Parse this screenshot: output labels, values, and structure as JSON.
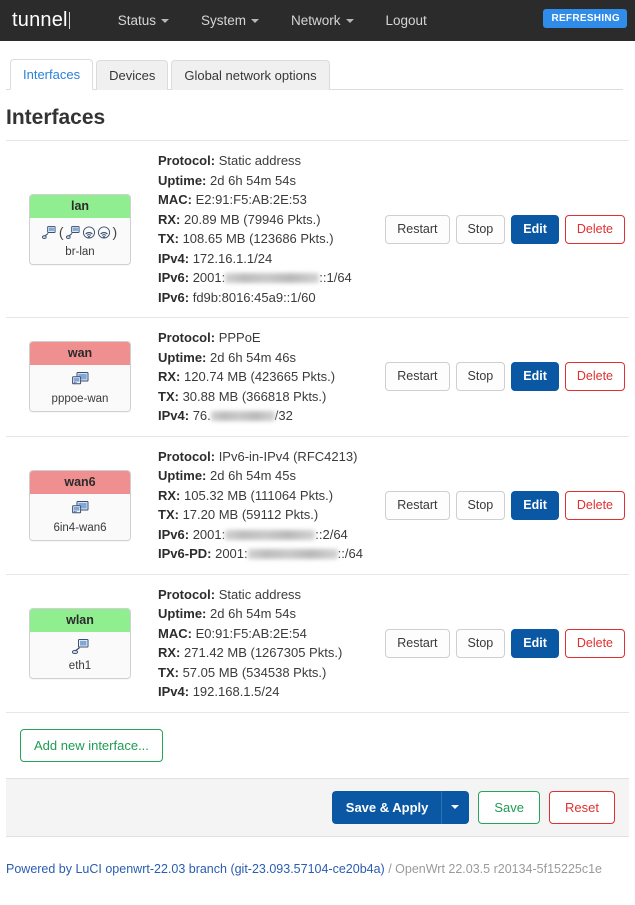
{
  "navbar": {
    "brand": "tunnel",
    "items": [
      {
        "label": "Status",
        "has_caret": true
      },
      {
        "label": "System",
        "has_caret": true
      },
      {
        "label": "Network",
        "has_caret": true
      },
      {
        "label": "Logout",
        "has_caret": false
      }
    ],
    "status_badge": "REFRESHING",
    "badge_color": "#2f8ce8",
    "background": "#2b2b2b"
  },
  "tabs": [
    {
      "label": "Interfaces",
      "active": true
    },
    {
      "label": "Devices",
      "active": false
    },
    {
      "label": "Global network options",
      "active": false
    }
  ],
  "page_title": "Interfaces",
  "buttons": {
    "restart": "Restart",
    "stop": "Stop",
    "edit": "Edit",
    "delete": "Delete",
    "add_new": "Add new interface...",
    "save_apply": "Save & Apply",
    "save": "Save",
    "reset": "Reset"
  },
  "labels": {
    "protocol": "Protocol:",
    "uptime": "Uptime:",
    "mac": "MAC:",
    "rx": "RX:",
    "tx": "TX:",
    "ipv4": "IPv4:",
    "ipv6": "IPv6:",
    "ipv6pd": "IPv6-PD:"
  },
  "interfaces": [
    {
      "name": "lan",
      "status_color": "green",
      "device": "br-lan",
      "icons": [
        "ethernet-icon",
        "ethernet-icon",
        "wifi-icon",
        "wifi-icon"
      ],
      "protocol": "Static address",
      "uptime": "2d 6h 54m 54s",
      "mac": "E2:91:F5:AB:2E:53",
      "rx": "20.89 MB (79946 Pkts.)",
      "tx": "108.65 MB (123686 Pkts.)",
      "ipv4": "172.16.1.1/24",
      "ipv6_redacted_prefix": "2001:",
      "ipv6_redacted_suffix": "::1/64",
      "ipv6_second": "fd9b:8016:45a9::1/60"
    },
    {
      "name": "wan",
      "status_color": "red",
      "device": "pppoe-wan",
      "icons": [
        "ethernet-icon"
      ],
      "protocol": "PPPoE",
      "uptime": "2d 6h 54m 46s",
      "rx": "120.74 MB (423665 Pkts.)",
      "tx": "30.88 MB (366818 Pkts.)",
      "ipv4_redacted_prefix": "76.",
      "ipv4_redacted_suffix": "/32"
    },
    {
      "name": "wan6",
      "status_color": "red",
      "device": "6in4-wan6",
      "icons": [
        "ethernet-icon"
      ],
      "protocol": "IPv6-in-IPv4 (RFC4213)",
      "uptime": "2d 6h 54m 45s",
      "rx": "105.32 MB (111064 Pkts.)",
      "tx": "17.20 MB (59112 Pkts.)",
      "ipv6_redacted_prefix": "2001:",
      "ipv6_redacted_suffix": "::2/64",
      "ipv6pd_redacted_prefix": "2001:",
      "ipv6pd_redacted_suffix": "::/64"
    },
    {
      "name": "wlan",
      "status_color": "green",
      "device": "eth1",
      "icons": [
        "ethernet-icon"
      ],
      "protocol": "Static address",
      "uptime": "2d 6h 54m 54s",
      "mac": "E0:91:F5:AB:2E:54",
      "rx": "271.42 MB (1267305 Pkts.)",
      "tx": "57.05 MB (534538 Pkts.)",
      "ipv4": "192.168.1.5/24"
    }
  ],
  "footer": {
    "powered_by": "Powered by LuCI openwrt-22.03 branch (git-23.093.57104-ce20b4a)",
    "separator": " / ",
    "version": "OpenWrt 22.03.5 r20134-5f15225c1e"
  },
  "colors": {
    "badge_green": "#90ee90",
    "badge_red": "#f08f8f",
    "primary_blue": "#0a57a4",
    "danger_red": "#e03030",
    "success_green": "#27a35a",
    "link_blue": "#2a5db0"
  }
}
